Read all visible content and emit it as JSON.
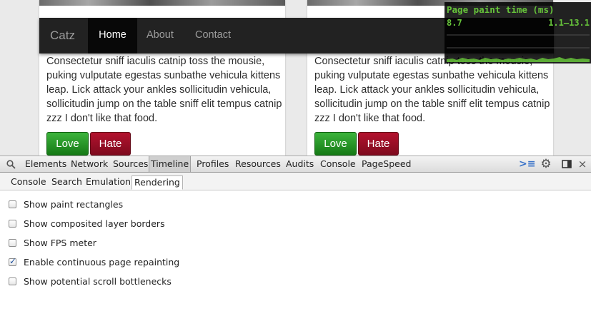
{
  "site": {
    "brand": "Catz",
    "nav": [
      {
        "label": "Home",
        "active": true
      },
      {
        "label": "About",
        "active": false
      },
      {
        "label": "Contact",
        "active": false
      }
    ],
    "card_text": "Consectetur sniff iaculis catnip toss the mousie, puking vulputate egestas sunbathe vehicula kittens leap. Lick attack your ankles sollicitudin vehicula, sollicitudin jump on the table sniff elit tempus catnip zzz I don't like that food.",
    "love_label": "Love",
    "hate_label": "Hate",
    "colors": {
      "navbar": "#222222",
      "love": "#2a9a2a",
      "hate": "#9a0e26"
    }
  },
  "paint_hud": {
    "title": "Page paint time (ms)",
    "current": "8.7",
    "range": "1.1–13.1",
    "color": "#66c33a"
  },
  "devtools": {
    "icons": {
      "search": "search-icon",
      "console": "console-drawer-icon",
      "settings": "gear-icon",
      "dock": "dock-icon",
      "close": "close-icon"
    },
    "tabs": [
      {
        "label": "Elements",
        "selected": false
      },
      {
        "label": "Network",
        "selected": false
      },
      {
        "label": "Sources",
        "selected": false
      },
      {
        "label": "Timeline",
        "selected": true
      },
      {
        "label": "Profiles",
        "selected": false
      },
      {
        "label": "Resources",
        "selected": false
      },
      {
        "label": "Audits",
        "selected": false
      },
      {
        "label": "Console",
        "selected": false
      },
      {
        "label": "PageSpeed",
        "selected": false
      }
    ],
    "drawer_tabs": [
      {
        "label": "Console",
        "selected": false
      },
      {
        "label": "Search",
        "selected": false
      },
      {
        "label": "Emulation",
        "selected": false
      },
      {
        "label": "Rendering",
        "selected": true
      }
    ],
    "rendering_options": [
      {
        "label": "Show paint rectangles",
        "checked": false
      },
      {
        "label": "Show composited layer borders",
        "checked": false
      },
      {
        "label": "Show FPS meter",
        "checked": false
      },
      {
        "label": "Enable continuous page repainting",
        "checked": true
      },
      {
        "label": "Show potential scroll bottlenecks",
        "checked": false
      }
    ]
  }
}
